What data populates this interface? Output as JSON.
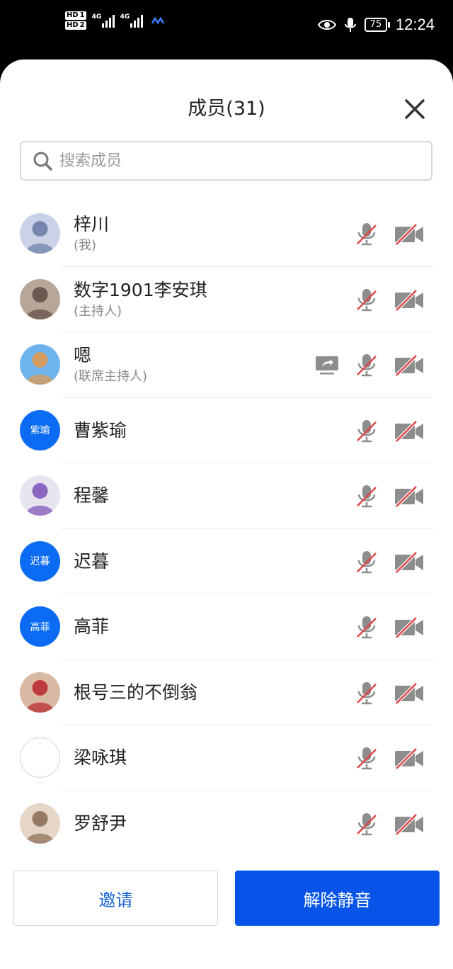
{
  "status_bar": {
    "hd1": "HD",
    "hd1_num": "1",
    "hd2": "HD",
    "hd2_num": "2",
    "sig1_label": "4G",
    "sig2_label": "4G",
    "battery": "75",
    "time": "12:24"
  },
  "header": {
    "title": "成员(31)"
  },
  "search": {
    "placeholder": "搜索成员"
  },
  "members": [
    {
      "name": "梓川",
      "role": "(我)",
      "avatar": "photo",
      "sharing": false
    },
    {
      "name": "数字1901李安琪",
      "role": "(主持人)",
      "avatar": "photo",
      "sharing": false
    },
    {
      "name": "嗯",
      "role": "(联席主持人)",
      "avatar": "photo",
      "sharing": true
    },
    {
      "name": "曹紫瑜",
      "role": "",
      "avatar": "text",
      "avatar_text": "紫瑜",
      "sharing": false
    },
    {
      "name": "程馨",
      "role": "",
      "avatar": "photo",
      "sharing": false
    },
    {
      "name": "迟暮",
      "role": "",
      "avatar": "text",
      "avatar_text": "迟暮",
      "sharing": false
    },
    {
      "name": "高菲",
      "role": "",
      "avatar": "text",
      "avatar_text": "高菲",
      "sharing": false
    },
    {
      "name": "根号三的不倒翁",
      "role": "",
      "avatar": "photo",
      "sharing": false
    },
    {
      "name": "梁咏琪",
      "role": "",
      "avatar": "blank",
      "sharing": false
    },
    {
      "name": "罗舒尹",
      "role": "",
      "avatar": "photo",
      "sharing": false
    }
  ],
  "footer": {
    "invite_label": "邀请",
    "unmute_label": "解除静音"
  },
  "colors": {
    "accent": "#0755e8",
    "invite_text": "#1663d7",
    "avatar_blue": "#0b6cf3",
    "muted_slash": "#e04545"
  }
}
